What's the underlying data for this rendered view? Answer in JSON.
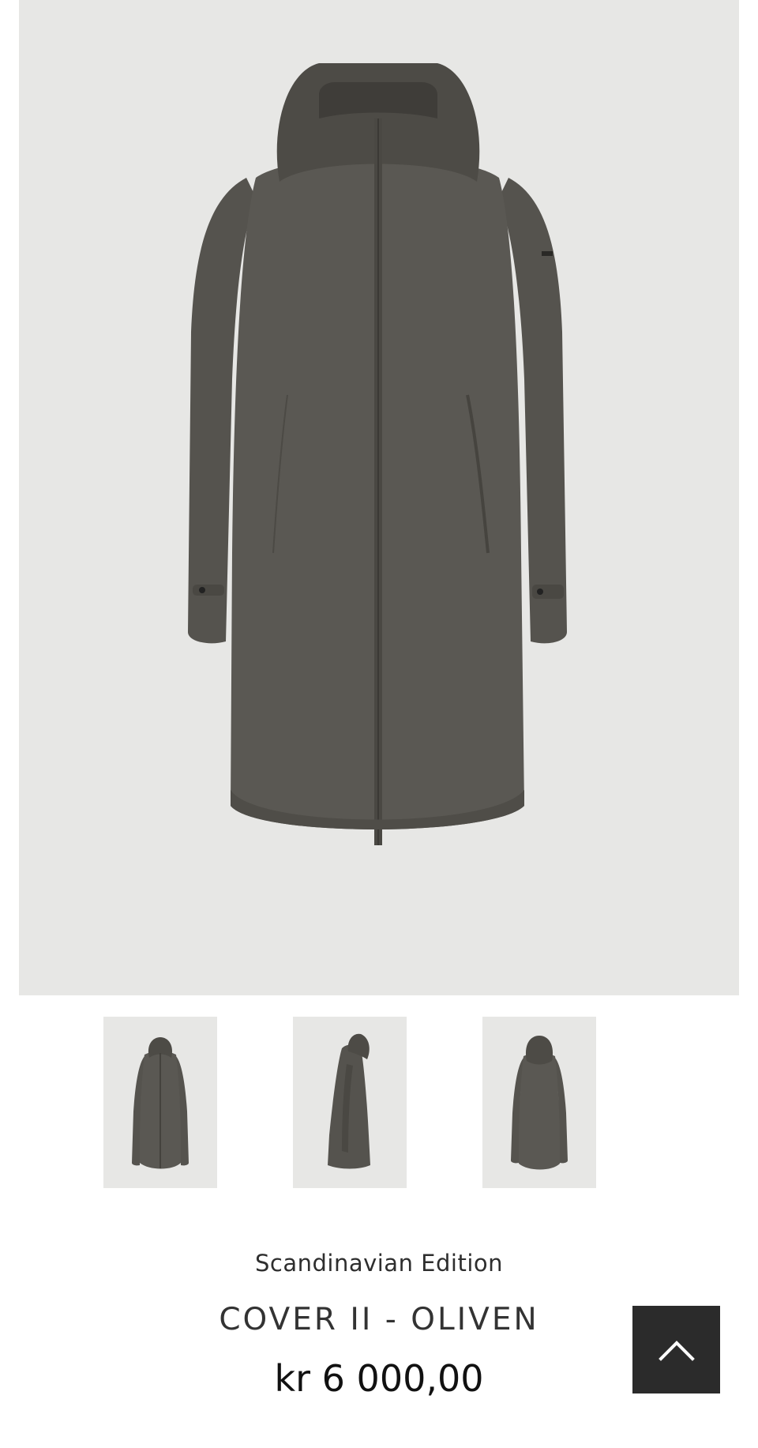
{
  "product": {
    "brand": "Scandinavian Edition",
    "name": "COVER II - OLIVEN",
    "price": "kr 6 000,00"
  },
  "gallery": {
    "main_image_icon": "coat-front-photo",
    "thumbnails": [
      {
        "view": "front",
        "icon": "coat-front-thumbnail"
      },
      {
        "view": "side",
        "icon": "coat-side-thumbnail"
      },
      {
        "view": "back",
        "icon": "coat-back-thumbnail"
      }
    ]
  },
  "scroll_top_button": {
    "icon": "chevron-up-icon"
  },
  "colors": {
    "image_background": "#e7e7e5",
    "coat": "#585651",
    "coat_shadow": "#46443f",
    "scroll_button": "#2b2b2b",
    "text": "#333333"
  }
}
